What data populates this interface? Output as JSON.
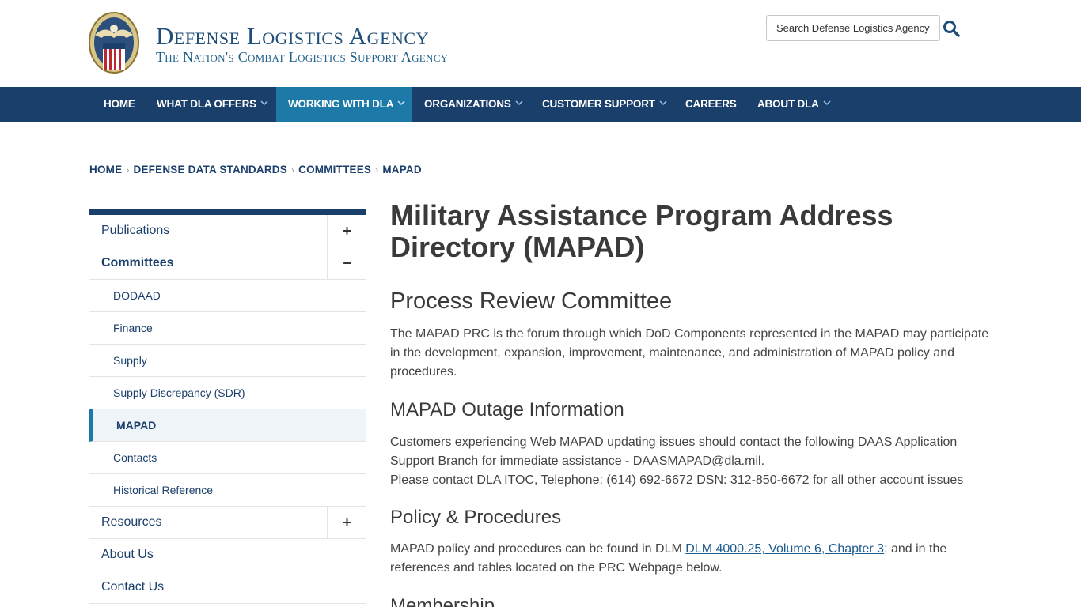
{
  "header": {
    "title": "Defense Logistics Agency",
    "subtitle": "The Nation's Combat Logistics Support Agency",
    "search_placeholder": "Search Defense Logistics Agency"
  },
  "nav": {
    "items": [
      {
        "label": "HOME"
      },
      {
        "label": "WHAT DLA OFFERS"
      },
      {
        "label": "WORKING WITH DLA"
      },
      {
        "label": "ORGANIZATIONS"
      },
      {
        "label": "CUSTOMER SUPPORT"
      },
      {
        "label": "CAREERS"
      },
      {
        "label": "ABOUT DLA"
      }
    ],
    "active_index": 2
  },
  "breadcrumb": [
    "HOME",
    "DEFENSE DATA STANDARDS",
    "COMMITTEES",
    "MAPAD"
  ],
  "sidebar": {
    "publications": {
      "label": "Publications",
      "toggle": "+"
    },
    "committees": {
      "label": "Committees",
      "toggle": "−"
    },
    "sub": [
      "DODAAD",
      "Finance",
      "Supply",
      "Supply Discrepancy (SDR)",
      "MAPAD",
      "Contacts",
      "Historical Reference"
    ],
    "resources": {
      "label": "Resources",
      "toggle": "+"
    },
    "about": {
      "label": "About Us"
    },
    "contact": {
      "label": "Contact Us"
    }
  },
  "main": {
    "title": "Military Assistance Program Address Directory (MAPAD)",
    "prc_heading": "Process Review Committee",
    "prc_text": "The MAPAD PRC is the forum through which DoD Components represented in the MAPAD may participate in the development, expansion, improvement, maintenance, and administration of MAPAD policy and procedures.",
    "outage_heading": "MAPAD Outage Information",
    "outage_line1": "Customers experiencing Web MAPAD updating issues should contact the following DAAS Application Support Branch for immediate assistance - DAASMAPAD@dla.mil.",
    "outage_line2": "Please contact DLA ITOC, Telephone: (614) 692-6672 DSN: 312-850-6672 for all other account issues",
    "policy_heading": "Policy & Procedures",
    "policy_pre": "MAPAD policy and procedures can be found in DLM ",
    "policy_link": "DLM 4000.25, Volume 6, Chapter 3",
    "policy_post": "; and in the references and tables located on the PRC Webpage below.",
    "membership_heading": "Membership"
  },
  "colors": {
    "nav_bg": "#1b3f6b",
    "nav_active": "#1d7aa8",
    "brand": "#1f4e79"
  }
}
